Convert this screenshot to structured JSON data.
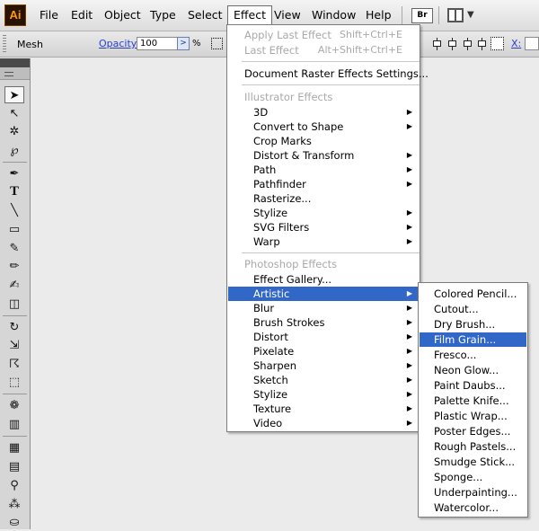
{
  "app": {
    "logo": "Ai"
  },
  "menubar": {
    "items": [
      "File",
      "Edit",
      "Object",
      "Type",
      "Select",
      "Effect",
      "View",
      "Window",
      "Help"
    ],
    "bridge_label": "Br"
  },
  "controlbar": {
    "selection_label": "Mesh",
    "opacity_label": "Opacity:",
    "opacity_value": "100",
    "percent": "%",
    "x_label": "X:"
  },
  "effect_menu": {
    "apply_last": {
      "label": "Apply Last Effect",
      "shortcut": "Shift+Ctrl+E"
    },
    "last_effect": {
      "label": "Last Effect",
      "shortcut": "Alt+Shift+Ctrl+E"
    },
    "raster_settings": "Document Raster Effects Settings...",
    "illustrator_header": "Illustrator Effects",
    "illustrator_items": [
      "3D",
      "Convert to Shape",
      "Crop Marks",
      "Distort & Transform",
      "Path",
      "Pathfinder",
      "Rasterize...",
      "Stylize",
      "SVG Filters",
      "Warp"
    ],
    "photoshop_header": "Photoshop Effects",
    "photoshop_items": [
      "Effect Gallery...",
      "Artistic",
      "Blur",
      "Brush Strokes",
      "Distort",
      "Pixelate",
      "Sharpen",
      "Sketch",
      "Stylize",
      "Texture",
      "Video"
    ]
  },
  "artistic_menu": {
    "items": [
      "Colored Pencil...",
      "Cutout...",
      "Dry Brush...",
      "Film Grain...",
      "Fresco...",
      "Neon Glow...",
      "Paint Daubs...",
      "Palette Knife...",
      "Plastic Wrap...",
      "Poster Edges...",
      "Rough Pastels...",
      "Smudge Stick...",
      "Sponge...",
      "Underpainting...",
      "Watercolor..."
    ]
  },
  "colors": {
    "highlight": "#3168c8",
    "logo_fg": "#ff9a00",
    "logo_bg": "#2a1200",
    "link": "#2a3fd0"
  }
}
